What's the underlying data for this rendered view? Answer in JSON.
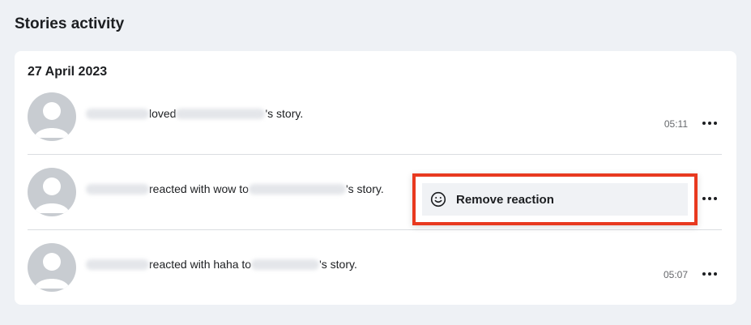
{
  "page": {
    "title": "Stories activity"
  },
  "group": {
    "date": "27 April 2023",
    "items": [
      {
        "verb": "loved",
        "suffix": "'s story.",
        "time": "05:11"
      },
      {
        "verb": "reacted with wow to",
        "suffix": "'s story.",
        "time": ""
      },
      {
        "verb": "reacted with haha to",
        "suffix": "'s story.",
        "time": "05:07"
      }
    ]
  },
  "context_menu": {
    "remove_label": "Remove reaction",
    "icon": "smiley-icon"
  },
  "colors": {
    "highlight": "#e8391f",
    "card": "#ffffff",
    "background": "#eef1f5"
  }
}
